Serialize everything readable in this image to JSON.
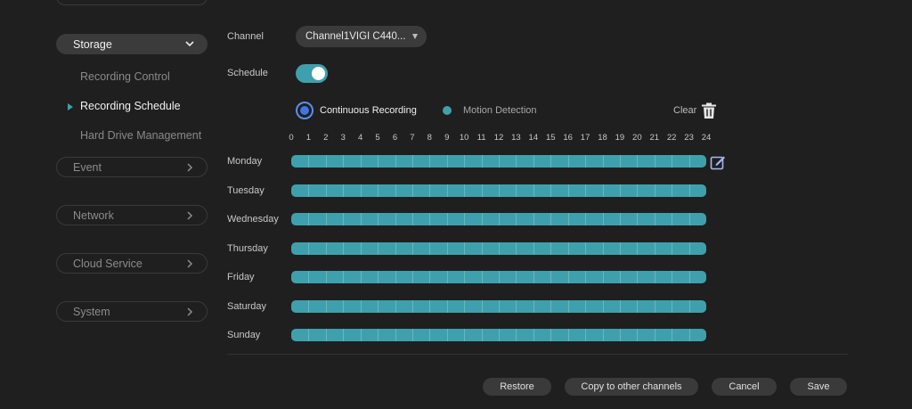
{
  "sidebar": {
    "sections": [
      {
        "label": "Storage",
        "active": true
      },
      {
        "label": "Event"
      },
      {
        "label": "Network"
      },
      {
        "label": "Cloud Service"
      },
      {
        "label": "System"
      }
    ],
    "storage_items": [
      {
        "label": "Recording Control"
      },
      {
        "label": "Recording Schedule",
        "active": true
      },
      {
        "label": "Hard Drive Management"
      }
    ]
  },
  "channel": {
    "label": "Channel",
    "value": "Channel1VIGI C440..."
  },
  "schedule": {
    "label": "Schedule",
    "enabled": true
  },
  "legend": {
    "continuous": "Continuous Recording",
    "motion": "Motion Detection",
    "clear": "Clear"
  },
  "hours": [
    "0",
    "1",
    "2",
    "3",
    "4",
    "5",
    "6",
    "7",
    "8",
    "9",
    "10",
    "11",
    "12",
    "13",
    "14",
    "15",
    "16",
    "17",
    "18",
    "19",
    "20",
    "21",
    "22",
    "23",
    "24"
  ],
  "days": [
    {
      "name": "Monday",
      "recording": "continuous",
      "coverage": "0-24"
    },
    {
      "name": "Tuesday",
      "recording": "continuous",
      "coverage": "0-24"
    },
    {
      "name": "Wednesday",
      "recording": "continuous",
      "coverage": "0-24"
    },
    {
      "name": "Thursday",
      "recording": "continuous",
      "coverage": "0-24"
    },
    {
      "name": "Friday",
      "recording": "continuous",
      "coverage": "0-24"
    },
    {
      "name": "Saturday",
      "recording": "continuous",
      "coverage": "0-24"
    },
    {
      "name": "Sunday",
      "recording": "continuous",
      "coverage": "0-24"
    }
  ],
  "buttons": {
    "restore": "Restore",
    "copy": "Copy to other channels",
    "cancel": "Cancel",
    "save": "Save"
  },
  "colors": {
    "accent": "#3fa0ad",
    "continuous_radio": "#3f76e3",
    "background": "#1f1f1f",
    "pill": "#3b3b3b"
  }
}
